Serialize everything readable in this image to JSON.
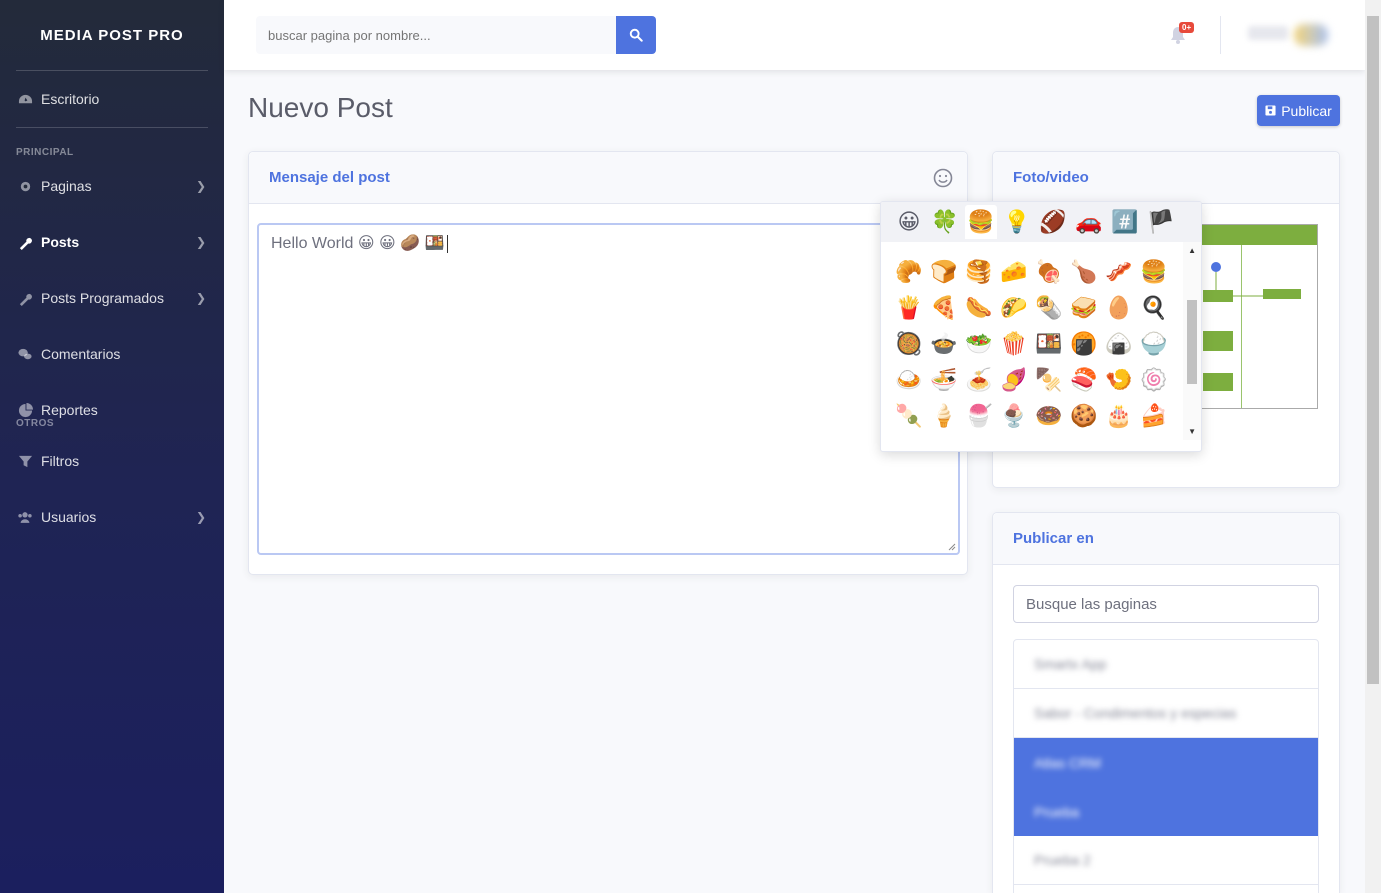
{
  "sidebar": {
    "brand": "MEDIA POST PRO",
    "dashboard": "Escritorio",
    "heading_principal": "PRINCIPAL",
    "heading_otros": "OTROS",
    "items": [
      {
        "label": "Paginas"
      },
      {
        "label": "Posts"
      },
      {
        "label": "Posts Programados"
      },
      {
        "label": "Comentarios"
      },
      {
        "label": "Reportes"
      },
      {
        "label": "Filtros"
      },
      {
        "label": "Usuarios"
      }
    ]
  },
  "topbar": {
    "search_placeholder": "buscar pagina por nombre...",
    "notif_badge": "0+"
  },
  "page": {
    "title": "Nuevo Post",
    "publish_label": "Publicar"
  },
  "message_card": {
    "title": "Mensaje del post",
    "text": "Hello World 😀 😀 🥔 🍱"
  },
  "emoji_picker": {
    "tabs": [
      "😀",
      "🍀",
      "🍔",
      "💡",
      "🏈",
      "🚗",
      "#️⃣",
      "🏴"
    ],
    "rows": [
      [
        "🥐",
        "🍞",
        "🥞",
        "🧀",
        "🍖",
        "🍗",
        "🥓",
        "🍔"
      ],
      [
        "🍟",
        "🍕",
        "🌭",
        "🌮",
        "🌯",
        "🥪",
        "🥚",
        "🍳"
      ],
      [
        "🥘",
        "🍲",
        "🥗",
        "🍿",
        "🍱",
        "🍘",
        "🍙",
        "🍚"
      ],
      [
        "🍛",
        "🍜",
        "🍝",
        "🍠",
        "🍢",
        "🍣",
        "🍤",
        "🍥"
      ],
      [
        "🍡",
        "🍦",
        "🍧",
        "🍨",
        "🍩",
        "🍪",
        "🎂",
        "🍰"
      ]
    ]
  },
  "photo_card": {
    "title": "Foto/video"
  },
  "publish_card": {
    "title": "Publicar en",
    "search_placeholder": "Busque las paginas",
    "pages": [
      "Smartx App",
      "Sabor - Condimentos y especias",
      "Atlas CRM",
      "Prueba",
      "Prueba 2"
    ]
  },
  "colors": {
    "accent": "#4e73df",
    "sidebar_top": "#232a3a",
    "sidebar_bottom": "#1b1f5e",
    "badge": "#e74a3b"
  }
}
